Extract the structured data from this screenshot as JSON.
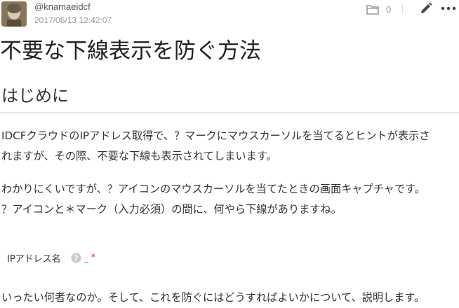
{
  "author": {
    "username": "@knamaeidcf",
    "date": "2017/06/13 12:42:07",
    "avatar_icon": "avatar-portrait"
  },
  "toolbar": {
    "folder_icon": "folder-icon",
    "folder_count": "0",
    "edit_icon": "pencil-icon",
    "more_icon": "ellipsis-icon"
  },
  "article": {
    "title": "不要な下線表示を防ぐ方法",
    "section_heading": "はじめに",
    "paragraphs": [
      {
        "lines": [
          "IDCFクラウドのIPアドレス取得で、？マークにマウスカーソルを当てるとヒントが表示さ",
          "れますが、その際、不要な下線も表示されてしまいます。"
        ]
      },
      {
        "lines": [
          "わかりにくいですが、？アイコンのマウスカーソルを当てたときの画面キャプチャです。",
          "？アイコンと＊マーク（入力必須）の間に、何やら下線がありますね。"
        ]
      },
      {
        "lines": [
          "いったい何者なのか。そして、これを防ぐにはどうすればよいかについて、説明します。"
        ]
      }
    ],
    "screenshot": {
      "label": "IPアドレス名",
      "required_mark": "*",
      "help_icon": "question-circle-icon"
    }
  },
  "colors": {
    "underline": "#3a8cd8",
    "required": "#e03030",
    "muted": "#999999"
  }
}
